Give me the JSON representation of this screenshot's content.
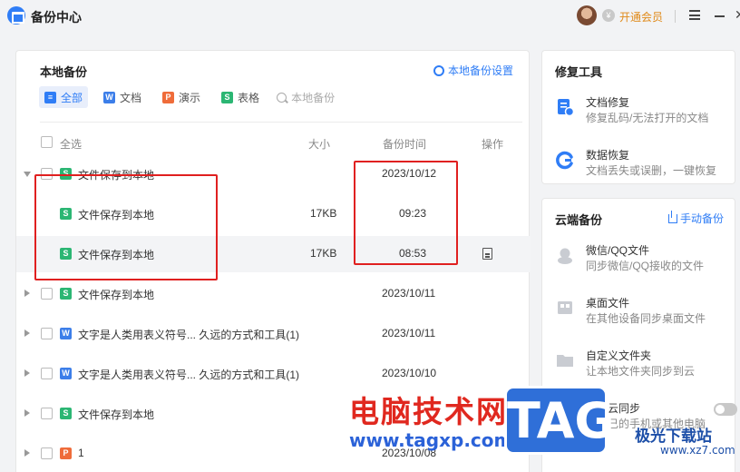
{
  "app": {
    "title": "备份中心"
  },
  "titlebar": {
    "vip_label": "开通会员",
    "vip_icon": "¥"
  },
  "local_backup": {
    "title": "本地备份",
    "settings_label": "本地备份设置",
    "filters": [
      {
        "label": "全部",
        "icon": "all",
        "glyph": "≡"
      },
      {
        "label": "文档",
        "icon": "doc",
        "glyph": "W"
      },
      {
        "label": "演示",
        "icon": "ppt",
        "glyph": "P"
      },
      {
        "label": "表格",
        "icon": "xls",
        "glyph": "S"
      }
    ],
    "search_placeholder": "本地备份",
    "columns": {
      "select_all": "全选",
      "size": "大小",
      "time": "备份时间",
      "action": "操作"
    },
    "rows": [
      {
        "name": "文件保存到本地",
        "size": "",
        "time": "2023/10/12",
        "icon": "xls",
        "glyph": "S",
        "expanded": true,
        "child": false
      },
      {
        "name": "文件保存到本地",
        "size": "17KB",
        "time": "09:23",
        "icon": "xls",
        "glyph": "S",
        "child": true
      },
      {
        "name": "文件保存到本地",
        "size": "17KB",
        "time": "08:53",
        "icon": "xls",
        "glyph": "S",
        "child": true,
        "highlighted": true
      },
      {
        "name": "文件保存到本地",
        "size": "",
        "time": "2023/10/11",
        "icon": "xls",
        "glyph": "S",
        "child": false
      },
      {
        "name": "文字是人类用表义符号...  久远的方式和工具(1)",
        "size": "",
        "time": "2023/10/11",
        "icon": "doc",
        "glyph": "W",
        "child": false
      },
      {
        "name": "文字是人类用表义符号...  久远的方式和工具(1)",
        "size": "",
        "time": "2023/10/10",
        "icon": "doc",
        "glyph": "W",
        "child": false
      },
      {
        "name": "文件保存到本地",
        "size": "",
        "time": "",
        "icon": "xls",
        "glyph": "S",
        "child": false
      },
      {
        "name": "1",
        "size": "",
        "time": "2023/10/08",
        "icon": "ppt",
        "glyph": "P",
        "child": false
      }
    ]
  },
  "repair_tools": {
    "title": "修复工具",
    "items": [
      {
        "name": "文档修复",
        "desc": "修复乱码/无法打开的文档",
        "icon": "doc-repair-icon"
      },
      {
        "name": "数据恢复",
        "desc": "文档丢失或误删，一键恢复",
        "icon": "data-recovery-icon"
      }
    ]
  },
  "cloud_backup": {
    "title": "云端备份",
    "action_label": "手动备份",
    "items": [
      {
        "name": "微信/QQ文件",
        "desc": "同步微信/QQ接收的文件",
        "icon": "chat-icon"
      },
      {
        "name": "桌面文件",
        "desc": "在其他设备同步桌面文件",
        "icon": "desktop-icon"
      },
      {
        "name": "自定义文件夹",
        "desc": "让本地文件夹同步到云",
        "icon": "folder-icon"
      },
      {
        "name": "文件云同步",
        "desc": "从自己的手机或其他电脑",
        "icon": "sync-icon"
      }
    ]
  },
  "watermark": {
    "site_cn": "电脑技术网",
    "site_url": "www.tagxp.com",
    "tag": "TAG",
    "xz": "极光下载站",
    "xz_url": "www.xz7.com"
  },
  "colors": {
    "accent": "#2f7df6",
    "vip": "#e08a19",
    "annotation": "#e02020"
  }
}
